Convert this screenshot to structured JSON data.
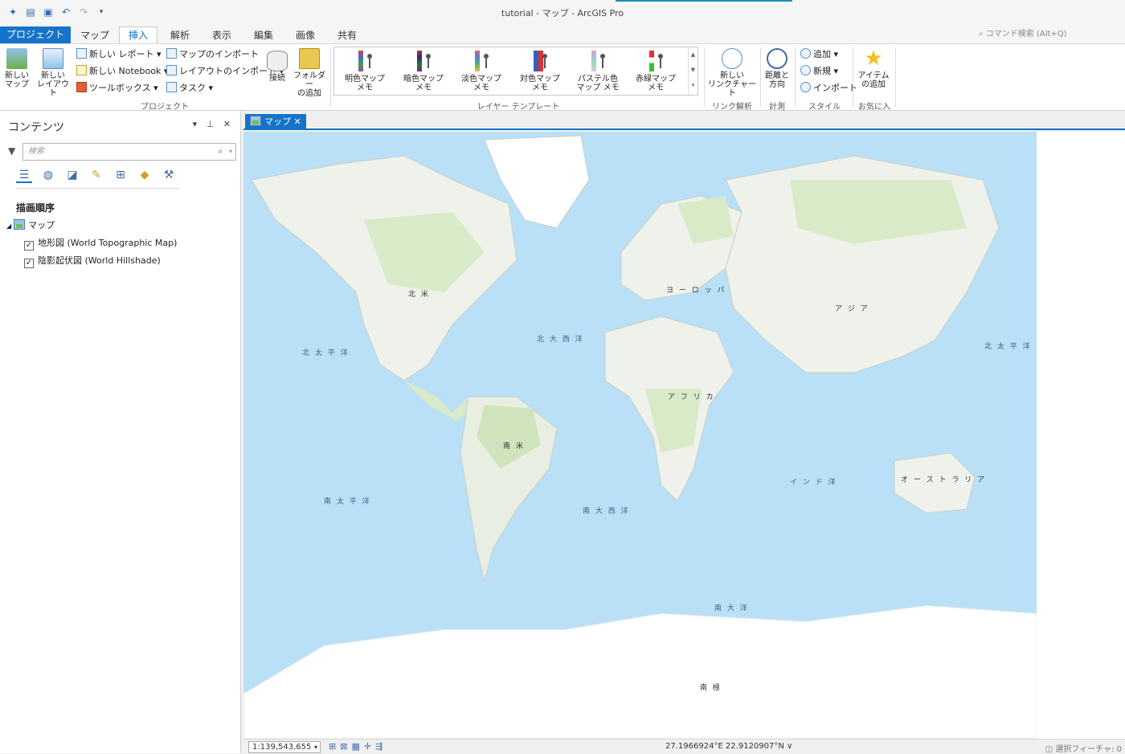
{
  "window": {
    "title": "tutorial - マップ - ArcGIS Pro"
  },
  "qat": {
    "icons": [
      "new-project-icon",
      "open-project-icon",
      "save-icon",
      "undo-icon",
      "redo-icon",
      "customize-icon"
    ]
  },
  "ribbon_tabs": [
    "プロジェクト",
    "マップ",
    "挿入",
    "解析",
    "表示",
    "編集",
    "画像",
    "共有"
  ],
  "command_search": {
    "placeholder": "コマンド検索 (Alt+Q)"
  },
  "groups": {
    "project": {
      "label": "プロジェクト",
      "new_map": "新しい\nマップ",
      "new_layout": "新しい\nレイアウト",
      "new_report": "新しい レポート",
      "new_notebook": "新しい Notebook",
      "toolbox": "ツールボックス",
      "import_map": "マップのインポート",
      "import_layout": "レイアウトのインポート",
      "task": "タスク",
      "connect": "接続",
      "add_folder": "フォルダー\nの追加"
    },
    "layer_template": {
      "label": "レイヤー テンプレート",
      "items": [
        "明色マップ\nメモ",
        "暗色マップ\nメモ",
        "淡色マップ\nメモ",
        "対色マップ\nメモ",
        "パステル色\nマップ メモ",
        "赤緑マップ\nメモ"
      ]
    },
    "link": {
      "label": "リンク解析",
      "new_link_chart": "新しい\nリンクチャート"
    },
    "measure": {
      "label": "計測",
      "distance_direction": "距離と\n方向"
    },
    "style": {
      "label": "スタイル",
      "add": "追加",
      "new": "新規",
      "import": "インポート"
    },
    "favorites": {
      "label": "お気に入り",
      "add_item": "アイテム\nの追加"
    }
  },
  "contents": {
    "title": "コンテンツ",
    "search_placeholder": "検索",
    "draw_order": "描画順序",
    "map_name": "マップ",
    "layers": [
      "地形図 (World Topographic Map)",
      "陰影起伏図 (World Hillshade)"
    ]
  },
  "map_view": {
    "tab_label": "マップ",
    "labels": {
      "north_america": "北 米",
      "europe": "ヨ ー ロ ッ パ",
      "asia": "ア ジ ア",
      "africa": "ア フ リ カ",
      "south_america": "南 米",
      "australia": "オ ー ス ト ラ リ ア",
      "antarctica": "南 極",
      "north_atlantic": "北 大 西 洋",
      "north_pacific_w": "北 太 平 洋",
      "north_pacific_e": "北 太 平 洋",
      "south_pacific": "南 太 平 洋",
      "south_atlantic": "南 大 西 洋",
      "indian_ocean": "イ ン ド 洋",
      "southern_ocean": "南 大 洋"
    }
  },
  "status": {
    "scale": "1:139,543,655",
    "coords": "27.1966924°E 22.9120907°N",
    "selected": "選択フィーチャ: 0"
  },
  "colors": {
    "accent": "#1573c9",
    "ocean": "#b9e0f6",
    "land": "#f2f2ee",
    "veg": "#d9eac8"
  }
}
